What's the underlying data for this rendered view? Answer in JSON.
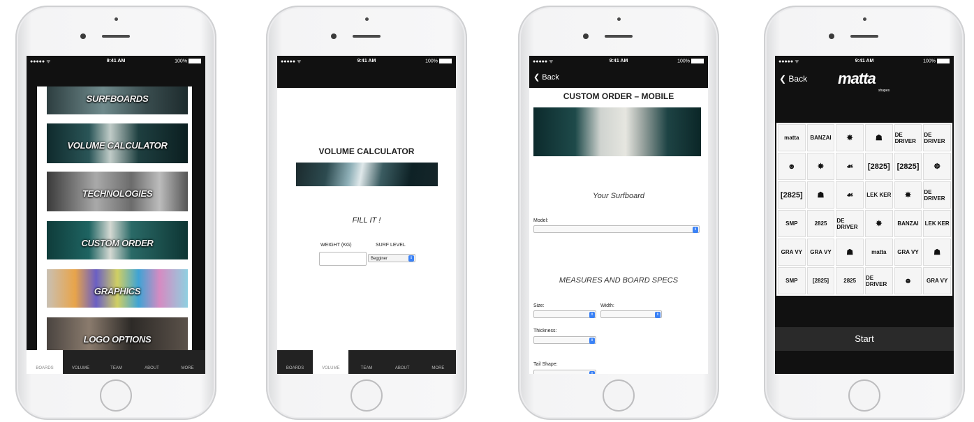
{
  "status": {
    "time": "9:41 AM",
    "battery": "100%",
    "signal": "●●●●● ᯤ"
  },
  "tabs": [
    "BOARDS",
    "VOLUME",
    "TEAM",
    "ABOUT",
    "MORE"
  ],
  "screen1": {
    "menu": [
      "SURFBOARDS",
      "VOLUME CALCULATOR",
      "TECHNOLOGIES",
      "CUSTOM ORDER",
      "GRAPHICS",
      "LOGO OPTIONS"
    ]
  },
  "screen2": {
    "title": "VOLUME CALCULATOR",
    "fill_label": "FILL IT !",
    "weight_label": "WEIGHT (KG)",
    "level_label": "SURF LEVEL",
    "level_value": "Begginer"
  },
  "screen3": {
    "back": "Back",
    "title": "CUSTOM ORDER – MOBILE",
    "section1": "Your Surfboard",
    "model_label": "Model:",
    "section2": "MEASURES AND BOARD SPECS",
    "size_label": "Size:",
    "width_label": "Width:",
    "thickness_label": "Thickness:",
    "tail_label": "Tail Shape:"
  },
  "screen4": {
    "back": "Back",
    "logo": "matta",
    "logo_sub": "shapes",
    "grid": [
      [
        "matta",
        "BANZAI",
        "✸",
        "☗",
        "DE DRIVER",
        "DE DRIVER"
      ],
      [
        "☻",
        "✸",
        "☙",
        "[2825]",
        "[2825]",
        "☸"
      ],
      [
        "[2825]",
        "☗",
        "☙",
        "LEK KER",
        "✸",
        "DE DRIVER"
      ],
      [
        "SMP",
        "2825",
        "DE DRIVER",
        "✸",
        "BANZAI",
        "LEK KER"
      ],
      [
        "GRA VY",
        "GRA VY",
        "☗",
        "matta",
        "GRA VY",
        "☗"
      ],
      [
        "SMP",
        "[2825]",
        "2825",
        "DE DRIVER",
        "☻",
        "GRA VY"
      ]
    ],
    "start": "Start"
  },
  "colors": {
    "screen_bg": "#111111",
    "accent_blue": "#3b82f6"
  }
}
